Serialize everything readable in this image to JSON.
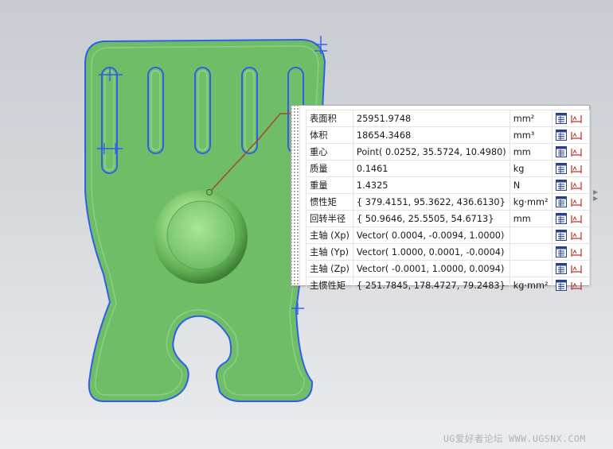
{
  "scene": {
    "colors": {
      "part_fill": "#6fbd67",
      "part_edge": "#2f5fe8",
      "background": "#d6d8dc",
      "leader": "#a04a32"
    }
  },
  "properties": {
    "rows": [
      {
        "label": "表面积",
        "value": "25951.9748",
        "unit": "mm²"
      },
      {
        "label": "体积",
        "value": "18654.3468",
        "unit": "mm³"
      },
      {
        "label": "重心",
        "value": "Point( 0.0252, 35.5724, 10.4980)",
        "unit": "mm"
      },
      {
        "label": "质量",
        "value": "0.1461",
        "unit": "kg"
      },
      {
        "label": "重量",
        "value": "1.4325",
        "unit": "N"
      },
      {
        "label": "惯性矩",
        "value": "{ 379.4151, 95.3622, 436.6130}",
        "unit": "kg·mm²"
      },
      {
        "label": "回转半径",
        "value": "{ 50.9646, 25.5505, 54.6713}",
        "unit": "mm"
      },
      {
        "label": "主轴 (Xp)",
        "value": "Vector( 0.0004, -0.0094, 1.0000)",
        "unit": ""
      },
      {
        "label": "主轴 (Yp)",
        "value": "Vector( 1.0000, 0.0001, -0.0004)",
        "unit": ""
      },
      {
        "label": "主轴 (Zp)",
        "value": "Vector( -0.0001, 1.0000, 0.0094)",
        "unit": ""
      },
      {
        "label": "主惯性矩",
        "value": "{ 251.7845, 178.4727, 79.2483}",
        "unit": "kg·mm²"
      }
    ],
    "row_icons": [
      "export-to-spreadsheet-icon",
      "measure-dimension-icon"
    ]
  },
  "watermark": "UG爱好者论坛 WWW.UGSNX.COM"
}
